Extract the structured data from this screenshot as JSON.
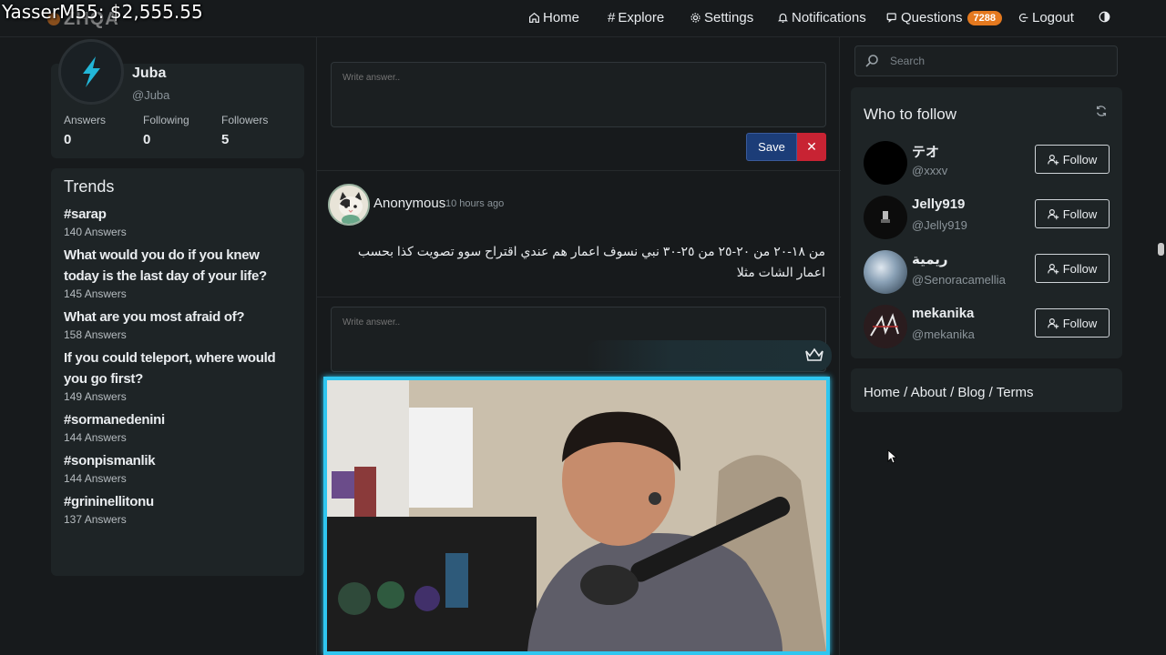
{
  "overlay": {
    "donation": "YasserM55: $2,555.55"
  },
  "brand": {
    "logo": "ZHQA"
  },
  "nav": {
    "home": "Home",
    "explore": "Explore",
    "settings": "Settings",
    "notifications": "Notifications",
    "questions": "Questions",
    "questions_count": "7288",
    "logout": "Logout"
  },
  "profile": {
    "name": "Juba",
    "handle": "@Juba",
    "stats": [
      {
        "label": "Answers",
        "value": "0"
      },
      {
        "label": "Following",
        "value": "0"
      },
      {
        "label": "Followers",
        "value": "5"
      }
    ]
  },
  "trends": {
    "title": "Trends",
    "items": [
      {
        "title": "#sarap",
        "count": "140 Answers"
      },
      {
        "title": "What would you do if you knew today is the last day of your life?",
        "count": "145 Answers"
      },
      {
        "title": "What are you most afraid of?",
        "count": "158 Answers"
      },
      {
        "title": "If you could teleport, where would you go first?",
        "count": "149 Answers"
      },
      {
        "title": "#sormanedenini",
        "count": "144 Answers"
      },
      {
        "title": "#sonpismanlik",
        "count": "144 Answers"
      },
      {
        "title": "#grininellitonu",
        "count": "137 Answers"
      }
    ]
  },
  "answer_box": {
    "placeholder": "Write answer..",
    "save": "Save",
    "close": "✕"
  },
  "post": {
    "author": "Anonymous",
    "time": "10 hours ago",
    "body": "من ١٨-٢٠ من ٢٠-٢٥ من ٢٥-٣٠ نبي نسوف اعمار هم عندي اقتراح سوو تصويت كذا بحسب اعمار الشات مثلا",
    "answer_placeholder": "Write answer.."
  },
  "search": {
    "placeholder": "Search"
  },
  "who_to_follow": {
    "title": "Who to follow",
    "follow_label": "Follow",
    "users": [
      {
        "name": "テオ",
        "handle": "@xxxv"
      },
      {
        "name": "Jelly919",
        "handle": "@Jelly919"
      },
      {
        "name": "ريمية",
        "handle": "@Senoracamellia"
      },
      {
        "name": "mekanika",
        "handle": "@mekanika"
      }
    ]
  },
  "footer": {
    "home": "Home",
    "about": "About",
    "blog": "Blog",
    "terms": "Terms",
    "separator": " / "
  },
  "colors": {
    "accent": "#e4791f",
    "background": "#171a1c",
    "card": "#1e2426",
    "save": "#1c3d78",
    "danger": "#c82333",
    "stream_border": "#2fc6f0"
  }
}
